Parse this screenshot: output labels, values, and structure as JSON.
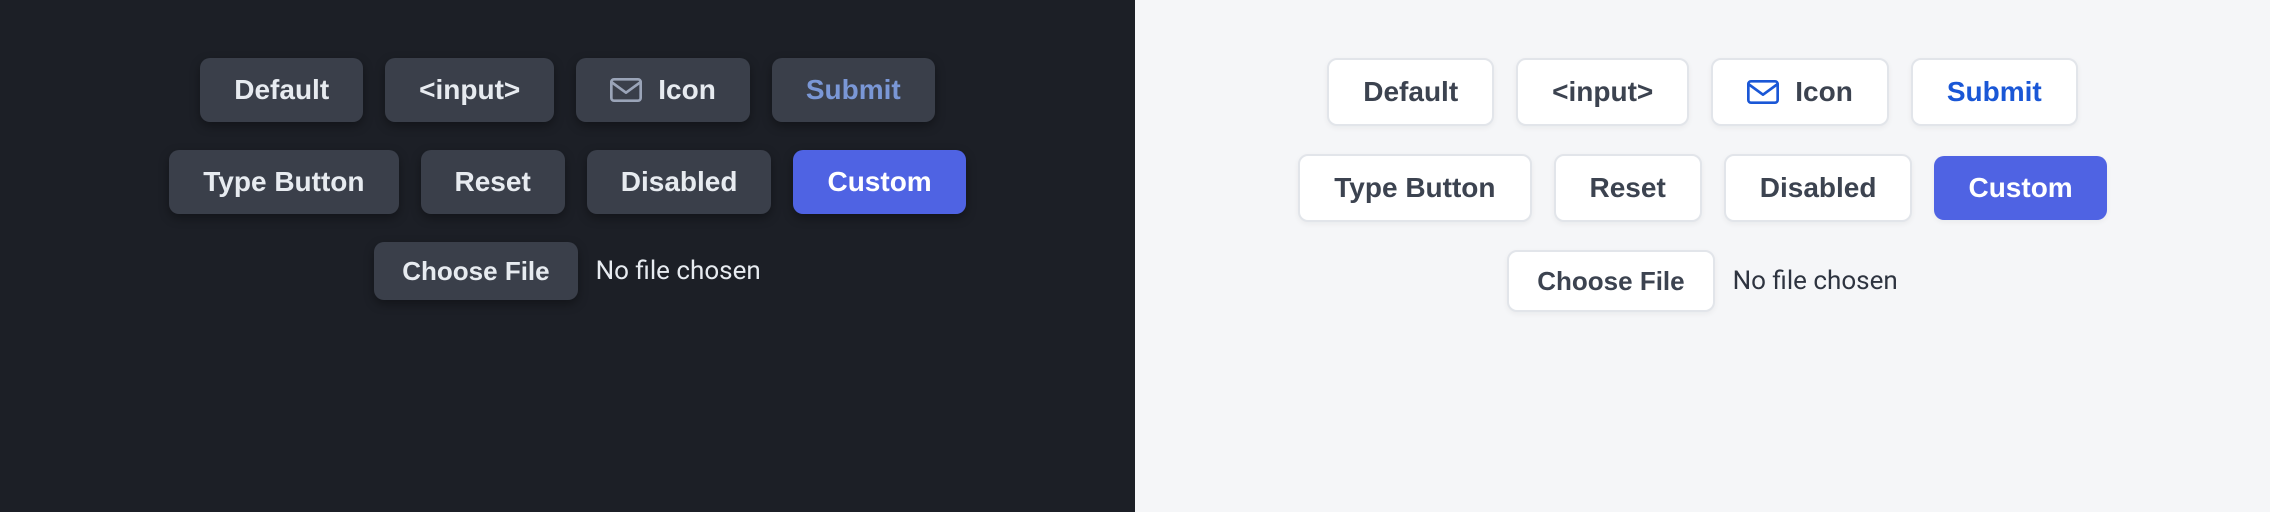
{
  "buttons": {
    "default": "Default",
    "input": "<input>",
    "icon": "Icon",
    "submit": "Submit",
    "type_button": "Type Button",
    "reset": "Reset",
    "disabled": "Disabled",
    "custom": "Custom",
    "choose_file": "Choose File"
  },
  "file_status": "No file chosen",
  "colors": {
    "dark_bg": "#1c1f26",
    "dark_btn": "#3a3f4a",
    "light_bg": "#f5f6f8",
    "light_btn": "#ffffff",
    "custom": "#4f63e3",
    "submit_dark": "#7a97d6",
    "submit_light": "#1a57d6"
  }
}
